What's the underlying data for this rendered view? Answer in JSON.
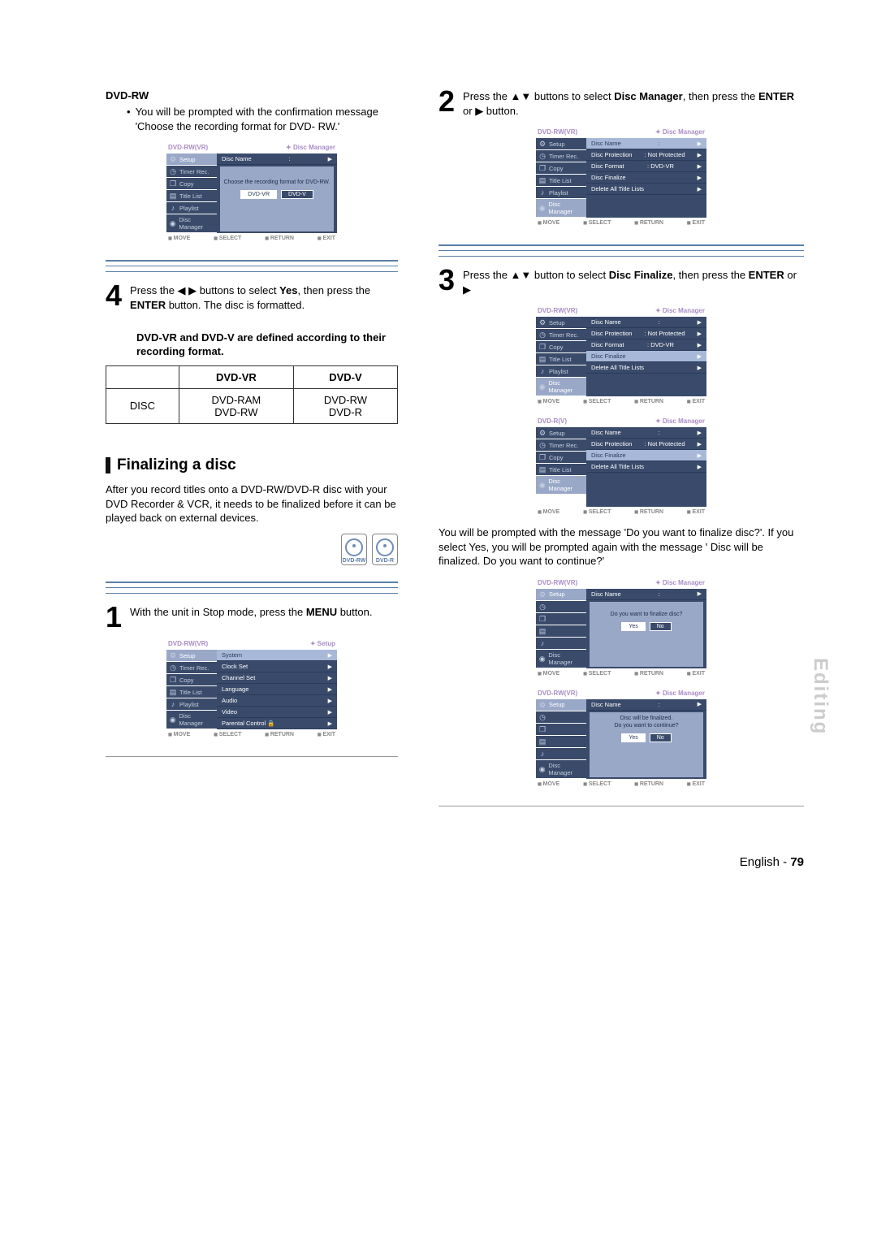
{
  "left": {
    "dvdrw_head": "DVD-RW",
    "bullet": "You will be prompted with the confirmation message 'Choose the recording format for DVD- RW.'",
    "step4_a": "Press the ◀ ▶ buttons to select ",
    "step4_yes": "Yes",
    "step4_b": ", then press the ",
    "step4_enter": "ENTER",
    "step4_c": " button. The disc is formatted.",
    "format_note": "DVD-VR and DVD-V are defined according to their recording format.",
    "table": {
      "h1": "DVD-VR",
      "h2": "DVD-V",
      "r1c0": "DISC",
      "r1c1a": "DVD-RAM",
      "r1c1b": "DVD-RW",
      "r1c2a": "DVD-RW",
      "r1c2b": "DVD-R"
    },
    "finalize_title": "Finalizing a disc",
    "finalize_intro": "After you record titles onto a DVD-RW/DVD-R disc with your DVD Recorder & VCR, it needs to be finalized before it can be played back on external devices.",
    "disc_icon_labels": [
      "DVD-RW",
      "DVD-R"
    ],
    "step1_a": "With the unit in Stop mode, press the ",
    "step1_menu": "MENU",
    "step1_b": " button."
  },
  "right": {
    "step2_a": "Press the ▲▼ buttons to select ",
    "step2_dm": "Disc Manager",
    "step2_b": ", then press the ",
    "step2_enter": "ENTER",
    "step2_c": " or ▶ button.",
    "step3_a": "Press the ▲▼ button to select ",
    "step3_df": "Disc Finalize",
    "step3_b": ", then press the ",
    "step3_enter": "ENTER",
    "step3_c": " or ▶",
    "prompt": "You will be prompted with the message 'Do you want to finalize disc?'. If you select Yes, you will be prompted again with the message ' Disc will be finalized. Do you want to continue?'"
  },
  "osd": {
    "title_vr": "DVD-RW(VR)",
    "title_v": "DVD-R(V)",
    "crumb_dm": "Disc Manager",
    "crumb_setup": "Setup",
    "side": [
      "Setup",
      "Timer Rec.",
      "Copy",
      "Title List",
      "Playlist",
      "Disc Manager"
    ],
    "side_short": [
      "Setup",
      "Timer Rec.",
      "Copy",
      "Title List",
      "Playlist",
      "Disc Manager"
    ],
    "setup_rows": [
      "System",
      "Clock Set",
      "Channel Set",
      "Language",
      "Audio",
      "Video",
      "Parental Control  🔒"
    ],
    "dm_rows": {
      "name": "Disc Name",
      "name_val": ":",
      "prot": "Disc Protection",
      "prot_val": ": Not Protected",
      "fmt": "Disc Format",
      "fmt_val": ": DVD-VR",
      "fin": "Disc Finalize",
      "del": "Delete All Title Lists"
    },
    "popup_format": "Choose the recording format for DVD-RW.",
    "popup_format_btns": [
      "DVD-VR",
      "DVD-V"
    ],
    "popup_finalize_q": "Do you want to finalize disc?",
    "popup_finalize_c1": "Disc will be finalized.",
    "popup_finalize_c2": "Do you want to continue?",
    "yes": "Yes",
    "no": "No",
    "foot": [
      "MOVE",
      "SELECT",
      "RETURN",
      "EXIT"
    ]
  },
  "footer": {
    "lang": "English",
    "sep": " - ",
    "page": "79"
  },
  "side_tab": "Editing"
}
